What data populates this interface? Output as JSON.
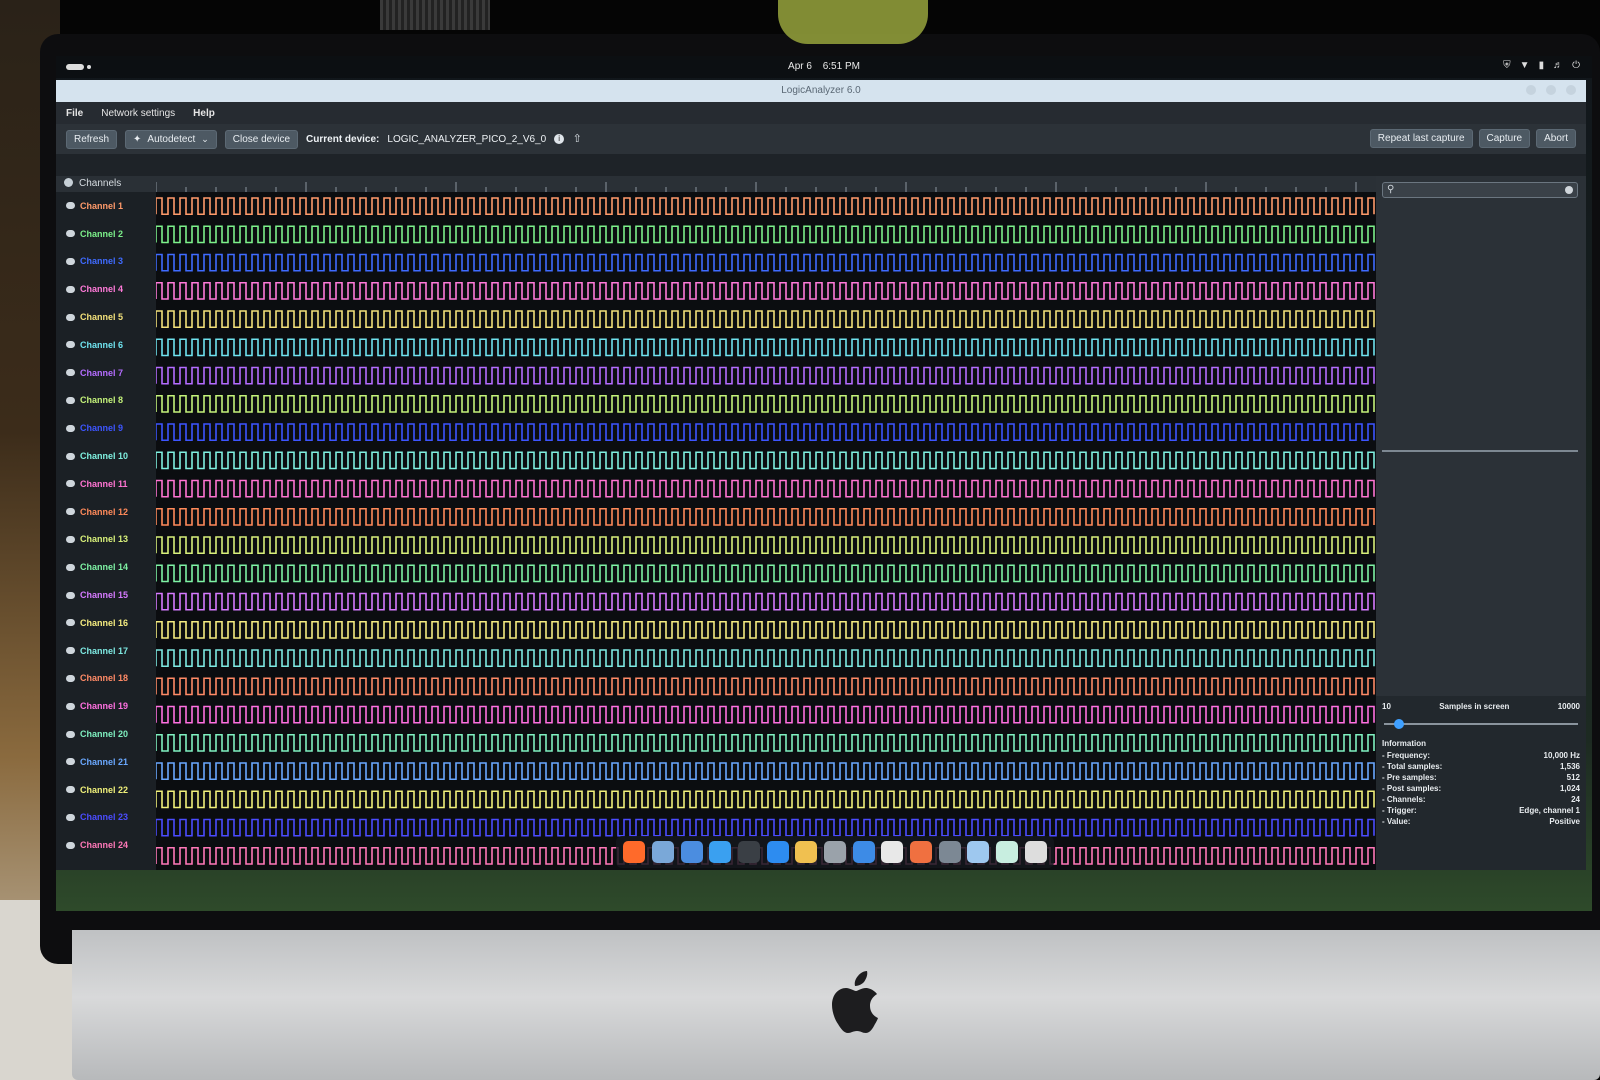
{
  "system": {
    "date": "Apr 6",
    "time": "6:51 PM"
  },
  "window": {
    "title": "LogicAnalyzer 6.0"
  },
  "menu": {
    "file": "File",
    "network": "Network settings",
    "help": "Help"
  },
  "toolbar": {
    "refresh": "Refresh",
    "autodetect": "Autodetect",
    "close_device": "Close device",
    "current_device_label": "Current device:",
    "current_device": "LOGIC_ANALYZER_PICO_2_V6_0",
    "repeat": "Repeat last capture",
    "capture": "Capture",
    "abort": "Abort"
  },
  "channels_header": "Channels",
  "channels": [
    {
      "name": "Channel 1",
      "color": "#ff9a6a"
    },
    {
      "name": "Channel 2",
      "color": "#7cf08a"
    },
    {
      "name": "Channel 3",
      "color": "#3f6bff"
    },
    {
      "name": "Channel 4",
      "color": "#ff7ad9"
    },
    {
      "name": "Channel 5",
      "color": "#f2e07a"
    },
    {
      "name": "Channel 6",
      "color": "#6fe3ef"
    },
    {
      "name": "Channel 7",
      "color": "#b46cff"
    },
    {
      "name": "Channel 8",
      "color": "#c4f27a"
    },
    {
      "name": "Channel 9",
      "color": "#3d55ff"
    },
    {
      "name": "Channel 10",
      "color": "#7ff0e0"
    },
    {
      "name": "Channel 11",
      "color": "#ff74d2"
    },
    {
      "name": "Channel 12",
      "color": "#ff8a5a"
    },
    {
      "name": "Channel 13",
      "color": "#d8f07a"
    },
    {
      "name": "Channel 14",
      "color": "#7ef2a4"
    },
    {
      "name": "Channel 15",
      "color": "#d67aff"
    },
    {
      "name": "Channel 16",
      "color": "#f5ec80"
    },
    {
      "name": "Channel 17",
      "color": "#7ee9e2"
    },
    {
      "name": "Channel 18",
      "color": "#ff8a66"
    },
    {
      "name": "Channel 19",
      "color": "#ff70e0"
    },
    {
      "name": "Channel 20",
      "color": "#7ff0c0"
    },
    {
      "name": "Channel 21",
      "color": "#6aa8ff"
    },
    {
      "name": "Channel 22",
      "color": "#f0f07a"
    },
    {
      "name": "Channel 23",
      "color": "#4b4cff"
    },
    {
      "name": "Channel 24",
      "color": "#ff78b8"
    }
  ],
  "samples": {
    "min": "10",
    "label": "Samples in screen",
    "max": "10000",
    "value": 10
  },
  "information": {
    "title": "Information",
    "rows": [
      {
        "label": "- Frequency:",
        "value": "10,000 Hz"
      },
      {
        "label": "- Total samples:",
        "value": "1,536"
      },
      {
        "label": "- Pre samples:",
        "value": "512"
      },
      {
        "label": "- Post samples:",
        "value": "1,024"
      },
      {
        "label": "- Channels:",
        "value": "24"
      },
      {
        "label": "- Trigger:",
        "value": "Edge, channel 1"
      },
      {
        "label": "- Value:",
        "value": "Positive"
      }
    ]
  },
  "dock_icons": [
    {
      "name": "firefox-icon",
      "color": "#ff6a2a"
    },
    {
      "name": "files-icon",
      "color": "#7aa8d8"
    },
    {
      "name": "calendar-icon",
      "color": "#4b8de0"
    },
    {
      "name": "help-icon",
      "color": "#3aa0f0"
    },
    {
      "name": "terminal-icon",
      "color": "#3a3f45"
    },
    {
      "name": "browser-icon",
      "color": "#2d8cf0"
    },
    {
      "name": "archive-icon",
      "color": "#f0c050"
    },
    {
      "name": "appcenter-icon",
      "color": "#9aa2aa"
    },
    {
      "name": "cloud-icon",
      "color": "#3d8be6"
    },
    {
      "name": "photos-icon",
      "color": "#e8e8e8"
    },
    {
      "name": "store-icon",
      "color": "#f07040"
    },
    {
      "name": "logicanalyzer-icon",
      "color": "#7c8894"
    },
    {
      "name": "settings-icon",
      "color": "#9ec8ef"
    },
    {
      "name": "tweaks-icon",
      "color": "#c8eee0"
    },
    {
      "name": "system-icon",
      "color": "#dddddd"
    }
  ]
}
